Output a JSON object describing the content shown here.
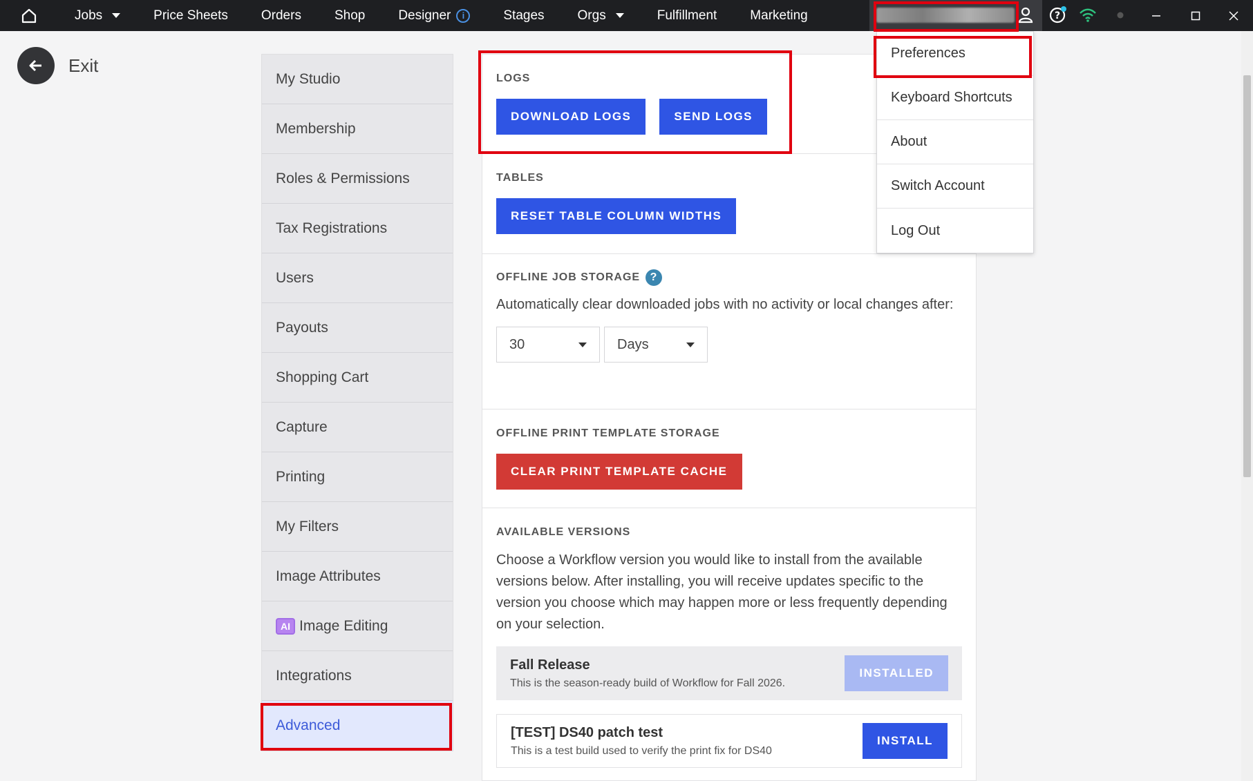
{
  "topbar": {
    "nav": [
      {
        "label": "Jobs",
        "has_caret": true
      },
      {
        "label": "Price Sheets"
      },
      {
        "label": "Orders"
      },
      {
        "label": "Shop"
      },
      {
        "label": "Designer",
        "has_info": true
      },
      {
        "label": "Stages"
      },
      {
        "label": "Orgs",
        "has_caret": true
      },
      {
        "label": "Fulfillment"
      },
      {
        "label": "Marketing"
      }
    ],
    "icons": [
      "home-icon",
      "user-icon",
      "help-icon",
      "wifi-icon",
      "status-dot-icon",
      "minimize-icon",
      "maximize-icon",
      "close-icon"
    ],
    "colors": {
      "bar": "#1e1f22",
      "wifi": "#2ec27e",
      "notification": "#2ec2e8"
    }
  },
  "exit": {
    "label": "Exit"
  },
  "sidebar": {
    "items": [
      {
        "label": "My Studio"
      },
      {
        "label": "Membership"
      },
      {
        "label": "Roles & Permissions"
      },
      {
        "label": "Tax Registrations"
      },
      {
        "label": "Users"
      },
      {
        "label": "Payouts"
      },
      {
        "label": "Shopping Cart"
      },
      {
        "label": "Capture"
      },
      {
        "label": "Printing"
      },
      {
        "label": "My Filters"
      },
      {
        "label": "Image Attributes"
      },
      {
        "label": "Image Editing",
        "badge": "AI"
      },
      {
        "label": "Integrations"
      },
      {
        "label": "Advanced",
        "active": true
      }
    ]
  },
  "main": {
    "logs": {
      "title": "LOGS",
      "download_label": "DOWNLOAD LOGS",
      "send_label": "SEND LOGS"
    },
    "tables": {
      "title": "TABLES",
      "reset_label": "RESET TABLE COLUMN WIDTHS"
    },
    "offline_job": {
      "title": "OFFLINE JOB STORAGE",
      "description": "Automatically clear downloaded jobs with no activity or local changes after:",
      "amount_value": "30",
      "unit_value": "Days"
    },
    "offline_print": {
      "title": "OFFLINE PRINT TEMPLATE STORAGE",
      "clear_label": "CLEAR PRINT TEMPLATE CACHE"
    },
    "versions": {
      "title": "AVAILABLE VERSIONS",
      "description": "Choose a Workflow version you would like to install from the available versions below. After installing, you will receive updates specific to the version you choose which may happen more or less frequently depending on your selection.",
      "items": [
        {
          "name": "Fall Release",
          "desc": "This is the season-ready build of Workflow for Fall 2026.",
          "action": "INSTALLED"
        },
        {
          "name": "[TEST] DS40 patch test",
          "desc": "This is a test build used to verify the print fix for DS40",
          "action": "INSTALL"
        }
      ]
    }
  },
  "user_menu": {
    "items": [
      {
        "label": "Preferences"
      },
      {
        "label": "Keyboard Shortcuts"
      },
      {
        "label": "About"
      },
      {
        "label": "Switch Account"
      },
      {
        "label": "Log Out"
      }
    ]
  }
}
